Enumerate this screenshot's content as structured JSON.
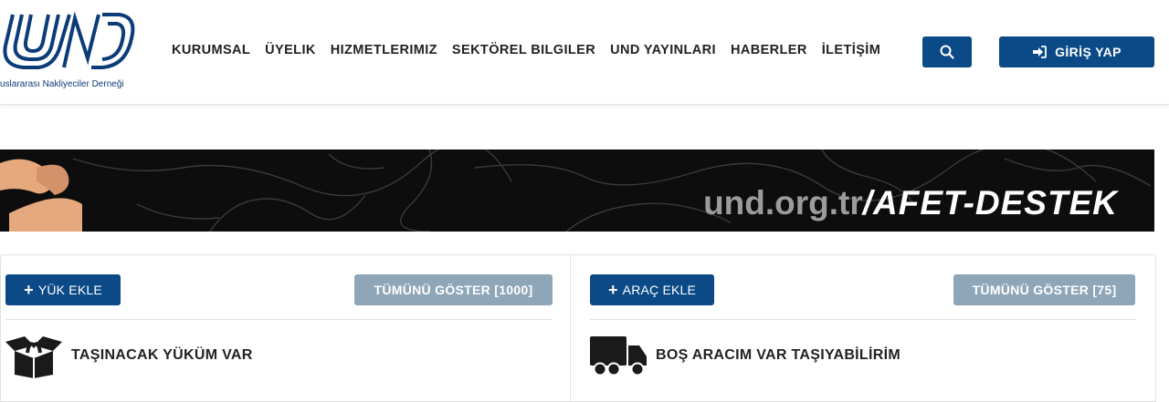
{
  "header": {
    "logo_text": "UND",
    "logo_tagline": "uslararası Nakliyeciler Derneği",
    "nav": [
      "KURUMSAL",
      "ÜYELIK",
      "HIZMETLERIMIZ",
      "SEKTÖREL BILGILER",
      "UND YAYINLARI",
      "HABERLER",
      "İLETİŞİM"
    ],
    "search_icon": "search-icon",
    "login_label": "GİRİŞ YAP",
    "login_icon": "sign-in-icon"
  },
  "banner": {
    "url_part": "und.org.tr",
    "path_part": "/AFET-DESTEK"
  },
  "left_panel": {
    "add_label": "YÜK EKLE",
    "show_all_label": "TÜMÜNÜ GÖSTER [1000]",
    "title": "TAŞINACAK YÜKÜM VAR",
    "icon": "open-box-icon"
  },
  "right_panel": {
    "add_label": "ARAÇ EKLE",
    "show_all_label": "TÜMÜNÜ GÖSTER [75]",
    "title": "BOŞ ARACIM VAR TAŞIYABİLİRİM",
    "icon": "truck-icon"
  },
  "colors": {
    "primary": "#0b4a86",
    "secondary_button": "#8fa6b8",
    "banner_bg": "#0d0d0d"
  }
}
